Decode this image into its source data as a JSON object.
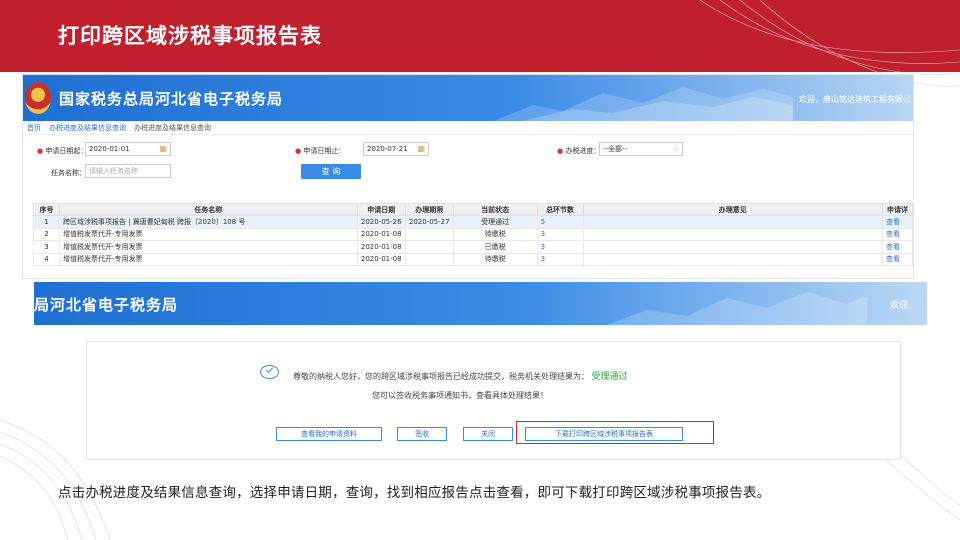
{
  "slide": {
    "title": "打印跨区域涉税事项报告表",
    "accent_color": "#c0202e",
    "caption": "点击办税进度及结果信息查询，选择申请日期，查询，找到相应报告点击查看，即可下载打印跨区域涉税事项报告表。"
  },
  "portal": {
    "name": "国家税务总局河北省电子税务局",
    "welcome": "欢迎，唐山铭达建筑工程有限公",
    "brand_color": "#1e6fd2"
  },
  "breadcrumb": {
    "home": "首页",
    "level1": "办税进度及结果信息查询",
    "level2": "办税进度及结果信息查询"
  },
  "form": {
    "start_label": "申请日期起：",
    "start_value": "2020-01-01",
    "end_label": "申请日期止：",
    "end_value": "2020-07-21",
    "progress_label": "办税进度：",
    "progress_value": "--全部--",
    "task_label": "任务名称：",
    "task_placeholder": "请输入任务名称",
    "query_button": "查 询"
  },
  "table": {
    "headers": [
      "序号",
      "任务名称",
      "申请日期",
      "办理期限",
      "当前状态",
      "总环节数",
      "办理意见",
      "申请详"
    ],
    "rows": [
      {
        "no": "1",
        "name": "跨区域涉税事项报告 | 冀唐曹妃甸税 跨报〔2020〕108 号",
        "date": "2020-05-26",
        "deadline": "2020-05-27",
        "status": "受理通过",
        "steps": "5",
        "opinion": "",
        "action": "查看"
      },
      {
        "no": "2",
        "name": "增值税发票代开-专用发票",
        "date": "2020-01-08",
        "deadline": "",
        "status": "待缴税",
        "steps": "3",
        "opinion": "",
        "action": "查看"
      },
      {
        "no": "3",
        "name": "增值税发票代开-专用发票",
        "date": "2020-01-08",
        "deadline": "",
        "status": "已缴税",
        "steps": "3",
        "opinion": "",
        "action": "查看"
      },
      {
        "no": "4",
        "name": "增值税发票代开-专用发票",
        "date": "2020-01-08",
        "deadline": "",
        "status": "待缴税",
        "steps": "3",
        "opinion": "",
        "action": "查看"
      }
    ]
  },
  "result": {
    "banner_name": "局河北省电子税务局",
    "banner_welcome": "欢迎，",
    "message_prefix": "尊敬的纳税人您好，您的跨区域涉税事项报告已经成功提交，税务机关处理结果为：",
    "message_status": "受理通过",
    "message_line2": "您可以签收税务事项通知书，查看具体处理结果！",
    "buttons": {
      "view_application": "查看我的申请资料",
      "sign": "签收",
      "close": "关闭",
      "download": "下载打印跨区域涉税事项报告表"
    },
    "status_color": "#2fa33b"
  }
}
